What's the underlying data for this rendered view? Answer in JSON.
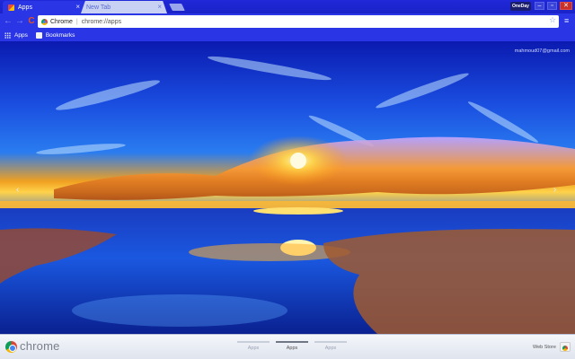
{
  "tabs": [
    {
      "title": "Apps",
      "active": true
    },
    {
      "title": "New Tab",
      "active": false
    }
  ],
  "window": {
    "profile_name": "OneDay",
    "minimize_symbol": "–",
    "maximize_symbol": "▫",
    "close_symbol": "✕"
  },
  "toolbar": {
    "back_symbol": "←",
    "forward_symbol": "→",
    "reload_symbol": "C",
    "site_label": "Chrome",
    "separator": "|",
    "url": "chrome://apps",
    "star_symbol": "☆",
    "menu_symbol": "≡"
  },
  "bookmarks": [
    {
      "label": "Apps",
      "icon": "apps-grid-icon"
    },
    {
      "label": "Bookmarks",
      "icon": "folder-icon"
    }
  ],
  "content": {
    "account_email": "mahmoud07@gmail.com",
    "prev_arrow": "‹",
    "next_arrow": "›"
  },
  "bottom_bar": {
    "brand": "chrome",
    "page_tabs": [
      {
        "label": "Apps",
        "active": false
      },
      {
        "label": "Apps",
        "active": true
      },
      {
        "label": "Apps",
        "active": false
      }
    ],
    "webstore_label": "Web Store"
  },
  "colors": {
    "frame": "#2a36e6",
    "tabstrip": "#1a22c8",
    "sky_top": "#0b1ab0",
    "sun": "#fff2a0",
    "close_button": "#c8312a"
  }
}
